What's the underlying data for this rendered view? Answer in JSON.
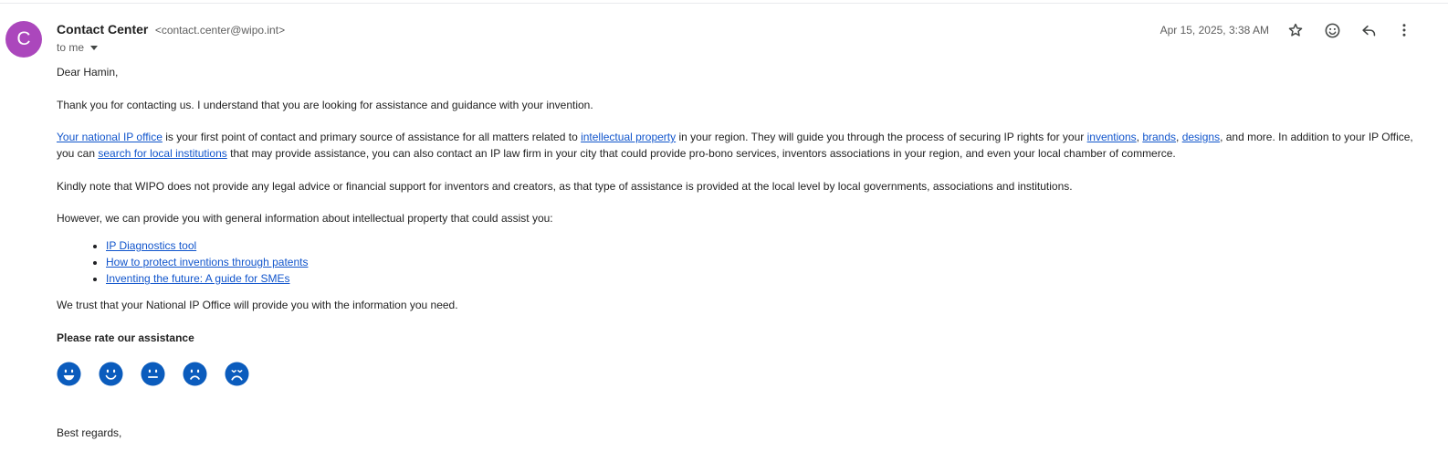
{
  "sender": {
    "initial": "C",
    "name": "Contact Center",
    "email": "<contact.center@wipo.int>",
    "recipient": "to me"
  },
  "date": "Apr 15, 2025, 3:38 AM",
  "icons": {
    "star": "star-icon",
    "emoji": "emoji-icon",
    "reply": "reply-icon",
    "more": "more-vert-icon"
  },
  "colors": {
    "avatar": "#ab47bc",
    "link": "#1155cc",
    "rating_face": "#0b5cbd"
  },
  "body": {
    "greeting": "Dear  Hamin,",
    "p1": "Thank you for contacting us. I understand that you are looking for assistance and guidance with your invention.",
    "p2": {
      "link_national": "Your national IP office",
      "t1": " is your first point of contact and primary source of assistance for all matters related to ",
      "link_ip": "intellectual property",
      "t2": " in your region. They will guide you through the process of securing IP rights for your ",
      "link_inventions": "inventions",
      "sep1": ", ",
      "link_brands": "brands",
      "sep2": ", ",
      "link_designs": "designs",
      "t3": ", and more. In addition to your IP Office,",
      "t4": "you can ",
      "link_search": "search for local institutions",
      "t5": " that may provide assistance, you can also contact an IP law firm in your city that could provide pro-bono services, inventors associations in your region, and even your local chamber of commerce."
    },
    "p3": "Kindly note that WIPO does not provide any legal advice or financial support for inventors and creators, as that type of assistance is provided at the local level by local governments, associations and institutions.",
    "p4": "However, we can provide you with general information about intellectual property that could assist you:",
    "links": [
      "IP Diagnostics tool",
      "How to protect inventions through patents",
      "Inventing the future: A guide for SMEs"
    ],
    "p5": "We trust that your National IP Office will provide you with the information you need.",
    "rating_heading": "Please rate our assistance",
    "rating_faces": [
      "very-happy-face-icon",
      "happy-face-icon",
      "neutral-face-icon",
      "sad-face-icon",
      "very-sad-face-icon"
    ],
    "closing": "Best regards,"
  }
}
